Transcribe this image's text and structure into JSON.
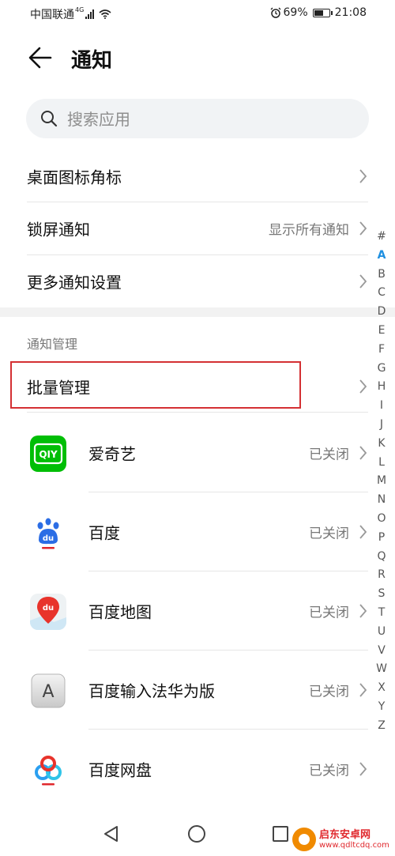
{
  "status_bar": {
    "carrier": "中国联通",
    "network": "4G",
    "battery_percent": "69%",
    "battery_level": 0.69,
    "time": "21:08"
  },
  "header": {
    "title": "通知",
    "back_icon": "arrow-left-icon"
  },
  "search": {
    "placeholder": "搜索应用",
    "value": ""
  },
  "settings_rows": [
    {
      "label": "桌面图标角标",
      "value": ""
    },
    {
      "label": "锁屏通知",
      "value": "显示所有通知"
    },
    {
      "label": "更多通知设置",
      "value": ""
    }
  ],
  "section": {
    "title": "通知管理"
  },
  "batch": {
    "label": "批量管理"
  },
  "apps": [
    {
      "name": "爱奇艺",
      "status": "已关闭",
      "icon": "iqiyi-icon"
    },
    {
      "name": "百度",
      "status": "已关闭",
      "icon": "baidu-icon"
    },
    {
      "name": "百度地图",
      "status": "已关闭",
      "icon": "baidu-map-icon"
    },
    {
      "name": "百度输入法华为版",
      "status": "已关闭",
      "icon": "baidu-input-icon"
    },
    {
      "name": "百度网盘",
      "status": "已关闭",
      "icon": "baidu-netdisk-icon"
    }
  ],
  "alphabet": [
    "#",
    "A",
    "B",
    "C",
    "D",
    "E",
    "F",
    "G",
    "H",
    "I",
    "J",
    "K",
    "L",
    "M",
    "N",
    "O",
    "P",
    "Q",
    "R",
    "S",
    "T",
    "U",
    "V",
    "W",
    "X",
    "Y",
    "Z"
  ],
  "alphabet_active": "A",
  "colors": {
    "accent": "#1e8fe0",
    "highlight_border": "#d43033",
    "iqiyi_green": "#00be06"
  },
  "watermark": {
    "name": "启东安卓网",
    "url": "www.qdltcdq.com"
  }
}
